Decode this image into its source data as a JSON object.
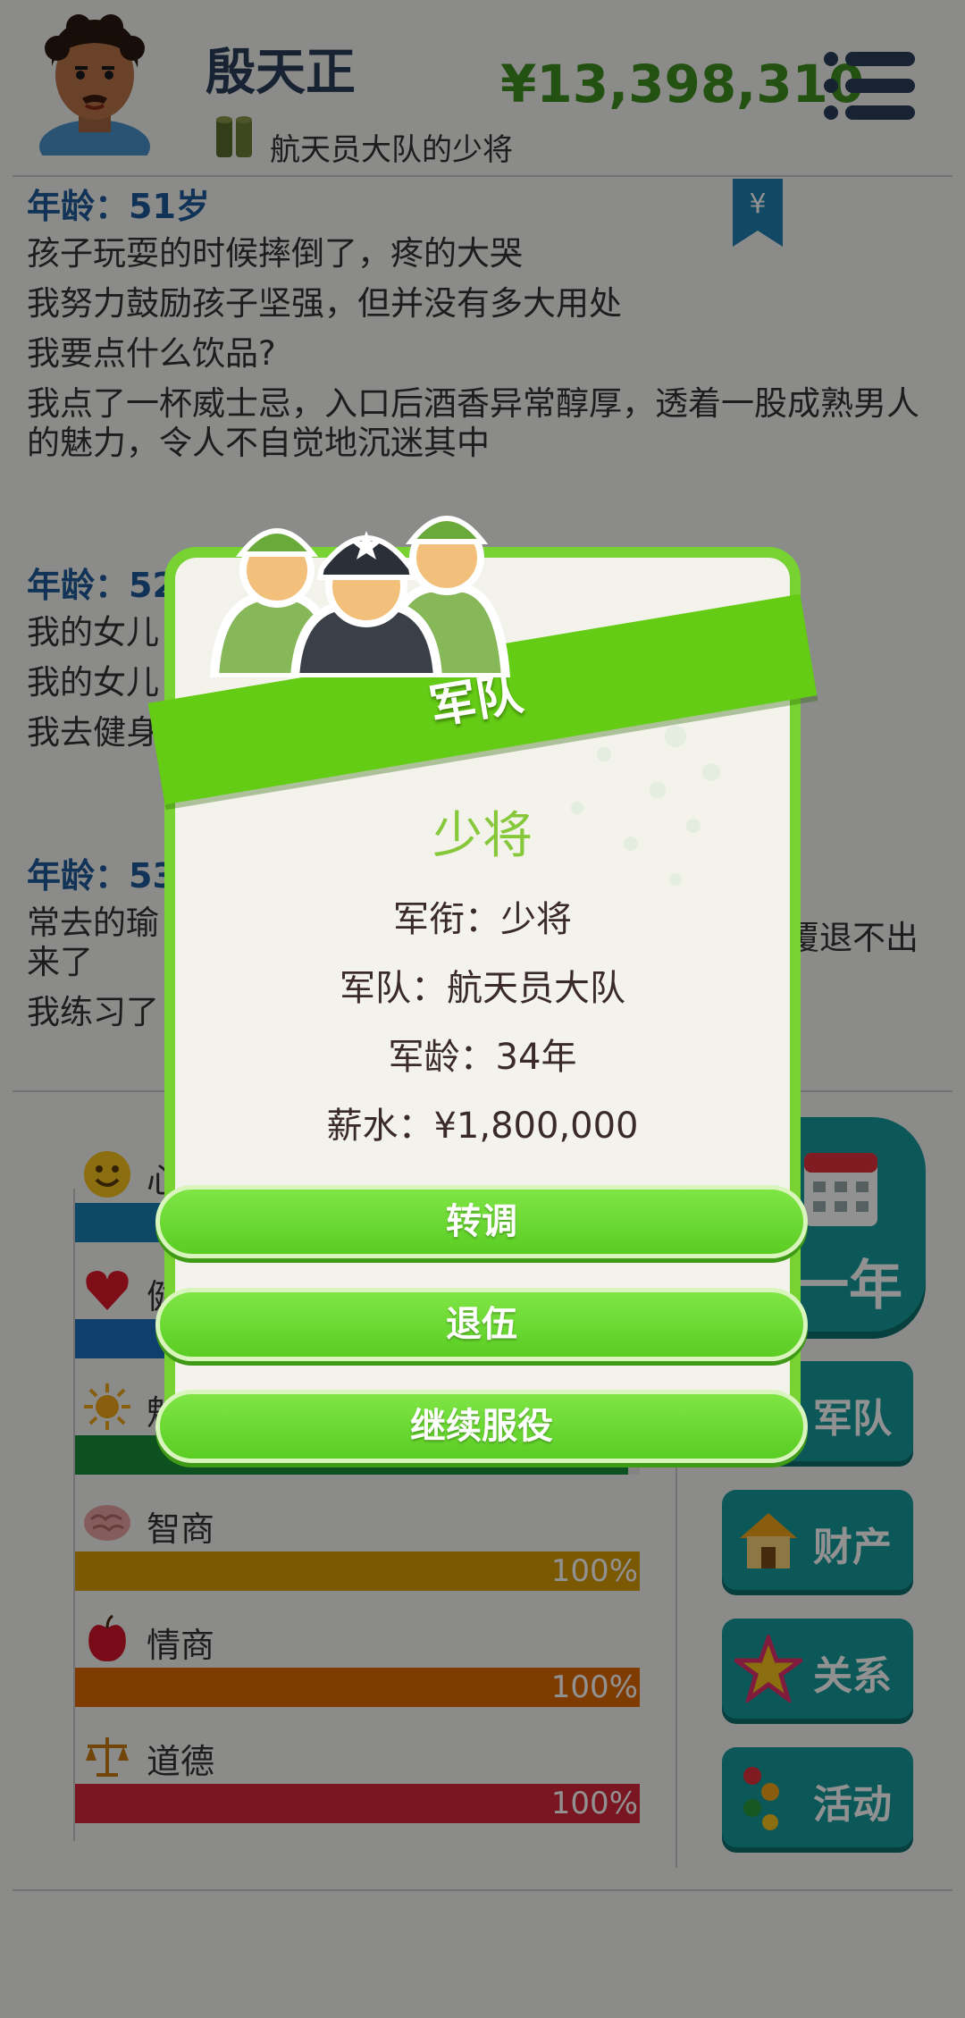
{
  "header": {
    "player_name": "殷天正",
    "player_title": "航天员大队的少将",
    "money": "¥13,398,310",
    "bookmark_symbol": "¥"
  },
  "log": [
    {
      "age": "年龄：51岁",
      "lines": [
        "孩子玩耍的时候摔倒了，疼的大哭",
        "我努力鼓励孩子坚强，但并没有多大用处",
        "我要点什么饮品?",
        "我点了一杯威士忌，入口后酒香异常醇厚，透着一股成熟男人的魅力，令人不自觉地沉迷其中"
      ]
    },
    {
      "age": "年龄：52",
      "lines": [
        "我的女儿",
        "我的女儿",
        "我去健身"
      ]
    },
    {
      "age": "年龄：53",
      "lines": [
        "常去的瑜",
        "来了",
        "我练习了"
      ],
      "line1_right": "覆退不出"
    }
  ],
  "stats": [
    {
      "label": "心",
      "value": "",
      "color": "#1a7fb5",
      "level": 1.0
    },
    {
      "label": "健",
      "value": "",
      "color": "#1f6fc0",
      "level": 1.0
    },
    {
      "label": "魅",
      "value": "98%",
      "color": "#1a8f3a",
      "level": 0.98
    },
    {
      "label": "智商",
      "value": "100%",
      "color": "#d69d05",
      "level": 1.0
    },
    {
      "label": "情商",
      "value": "100%",
      "color": "#e06a05",
      "level": 1.0
    },
    {
      "label": "道德",
      "value": "100%",
      "color": "#d6283a",
      "level": 1.0
    }
  ],
  "side_buttons": {
    "year": "一年",
    "military": "军队",
    "assets": "财产",
    "relations": "关系",
    "activities": "活动"
  },
  "modal": {
    "ribbon_title": "军队",
    "rank": "少将",
    "info_rank": "军衔：少将",
    "info_unit": "军队：航天员大队",
    "info_years": "军龄：34年",
    "info_salary": "薪水：¥1,800,000",
    "btn_transfer": "转调",
    "btn_retire": "退伍",
    "btn_continue": "继续服役"
  }
}
